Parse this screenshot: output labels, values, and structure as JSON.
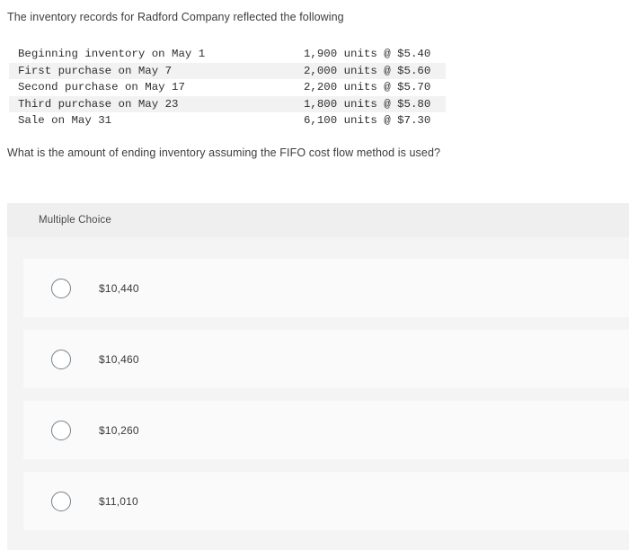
{
  "stem": "The inventory records for Radford Company reflected the following",
  "inventory_table": {
    "rows": [
      {
        "description": "Beginning inventory on May 1",
        "detail": "1,900 units @ $5.40"
      },
      {
        "description": "First purchase on May 7",
        "detail": "2,000 units @ $5.60"
      },
      {
        "description": "Second purchase on May 17",
        "detail": "2,200 units @ $5.70"
      },
      {
        "description": "Third purchase on May 23",
        "detail": "1,800 units @ $5.80"
      },
      {
        "description": "Sale on May 31",
        "detail": "6,100 units @ $7.30"
      }
    ]
  },
  "question": "What is the amount of ending inventory assuming the FIFO cost flow method is used?",
  "multiple_choice": {
    "header_label": "Multiple Choice",
    "options": [
      {
        "label": "$10,440",
        "selected": false
      },
      {
        "label": "$10,460",
        "selected": false
      },
      {
        "label": "$10,260",
        "selected": false
      },
      {
        "label": "$11,010",
        "selected": false
      }
    ]
  },
  "colors": {
    "page_background": "#ffffff",
    "panel_background": "#f4f4f4",
    "panel_header_background": "#efefef",
    "choice_card_background": "#fafafa",
    "table_stripe": "#f2f2f2",
    "body_text": "#3d3d3d",
    "radio_border": "#74818c"
  }
}
